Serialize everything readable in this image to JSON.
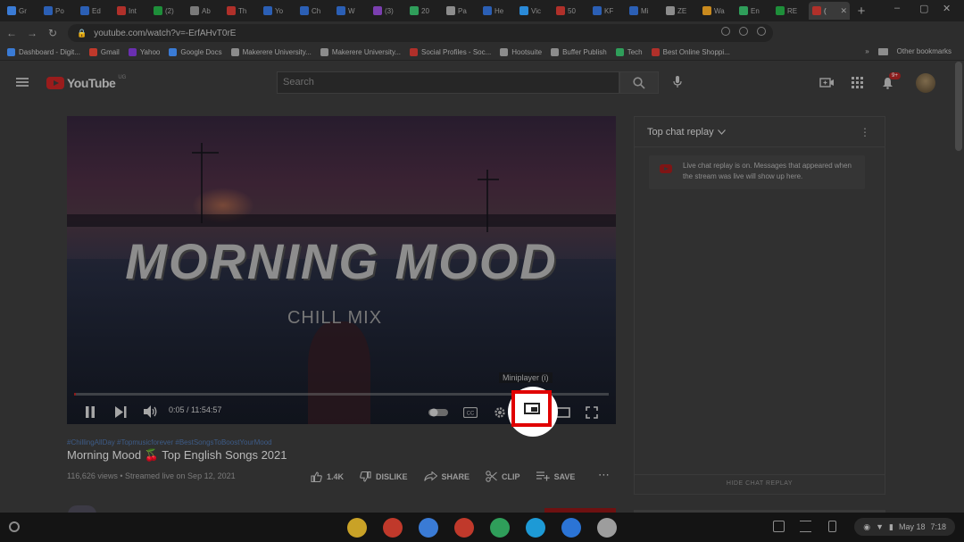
{
  "browser": {
    "tabs": [
      {
        "label": "Gr",
        "color": "#3a7bd5"
      },
      {
        "label": "Po",
        "color": "#2b5fb5"
      },
      {
        "label": "Ed",
        "color": "#2b5fb5"
      },
      {
        "label": "Int",
        "color": "#b0302a"
      },
      {
        "label": "(2)",
        "color": "#1e8f3a"
      },
      {
        "label": "Ab",
        "color": "#7a7a7a"
      },
      {
        "label": "Th",
        "color": "#b0302a"
      },
      {
        "label": "Yo",
        "color": "#2b5fb5"
      },
      {
        "label": "Ch",
        "color": "#2b5fb5"
      },
      {
        "label": "W",
        "color": "#2b5fb5"
      },
      {
        "label": "(3)",
        "color": "#7b3fb0"
      },
      {
        "label": "20",
        "color": "#2f9e5a"
      },
      {
        "label": "Pa",
        "color": "#8c8c8c"
      },
      {
        "label": "He",
        "color": "#2b5fb5"
      },
      {
        "label": "Vic",
        "color": "#2a8ad8"
      },
      {
        "label": "50",
        "color": "#b0302a"
      },
      {
        "label": "KF",
        "color": "#2b5fb5"
      },
      {
        "label": "Mi",
        "color": "#2b5fb5"
      },
      {
        "label": "ZE",
        "color": "#8c8c8c"
      },
      {
        "label": "Wa",
        "color": "#c98a1e"
      },
      {
        "label": "En",
        "color": "#2f9e5a"
      },
      {
        "label": "RE",
        "color": "#1e8f3a"
      }
    ],
    "active_tab": {
      "label": "("
    },
    "url": "youtube.com/watch?v=-ErfAHvT0rE",
    "bookmarks": [
      {
        "label": "Dashboard - Digit...",
        "color": "#3a7bd5"
      },
      {
        "label": "Gmail",
        "color": "#c0392b"
      },
      {
        "label": "Yahoo",
        "color": "#6a2fb0"
      },
      {
        "label": "Google Docs",
        "color": "#3a7bd5"
      },
      {
        "label": "Makerere University...",
        "color": "#8c8c8c"
      },
      {
        "label": "Makerere University...",
        "color": "#8c8c8c"
      },
      {
        "label": "Social Profiles - Soc...",
        "color": "#b0302a"
      },
      {
        "label": "Hootsuite",
        "color": "#8c8c8c"
      },
      {
        "label": "Buffer Publish",
        "color": "#8c8c8c"
      },
      {
        "label": "Tech",
        "color": "#2f9e5a"
      },
      {
        "label": "Best Online Shoppi...",
        "color": "#b0302a"
      }
    ],
    "bookmarks_overflow": "»",
    "other_bookmarks": "Other bookmarks"
  },
  "youtube": {
    "logo_text": "YouTube",
    "logo_sup": "UG",
    "search_placeholder": "Search",
    "notification_count": "9+",
    "video": {
      "title_overlay": "MORNING MOOD",
      "subtitle_overlay": "CHILL MIX",
      "time": "0:05 / 11:54:57",
      "progress": 0.0,
      "tooltip": "Miniplayer (i)"
    },
    "hashtags": "#ChillingAllDay #Topmusicforever #BestSongsToBoostYourMood",
    "title": "Morning Mood 🍒 Top English Songs 2021",
    "meta": "116,626 views • Streamed live on Sep 12, 2021",
    "actions": {
      "like": "1.4K",
      "dislike": "DISLIKE",
      "share": "SHARE",
      "clip": "CLIP",
      "save": "SAVE",
      "more": "⋯"
    },
    "chat": {
      "header": "Top chat replay",
      "message": "Live chat replay is on. Messages that appeared when the stream was live will show up here.",
      "hide": "HIDE CHAT REPLAY"
    }
  },
  "shelf": {
    "apps": [
      {
        "name": "chrome",
        "color": "#c9a227"
      },
      {
        "name": "gmail",
        "color": "#c0392b"
      },
      {
        "name": "docs",
        "color": "#3a7bd5"
      },
      {
        "name": "youtube",
        "color": "#c0392b"
      },
      {
        "name": "play-store",
        "color": "#2f9e5a"
      },
      {
        "name": "messages",
        "color": "#1d9ad6"
      },
      {
        "name": "files",
        "color": "#2b74d6"
      },
      {
        "name": "photos",
        "color": "#9d9d9d"
      }
    ],
    "date": "May 18",
    "time": "7:18"
  },
  "colors": {
    "youtube_red": "#e00000",
    "spotlight": "#ffffff"
  }
}
